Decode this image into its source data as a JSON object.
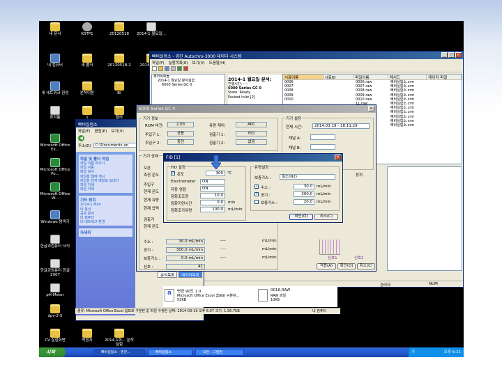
{
  "desktop_icons": [
    {
      "label": "내 문서",
      "type": "folder"
    },
    {
      "label": "KSTP1",
      "type": "cd"
    },
    {
      "label": "20120518",
      "type": "folder"
    },
    {
      "label": "2014-1 월요일...",
      "type": "disk"
    },
    {
      "label": "내 컴퓨터",
      "type": "pc"
    },
    {
      "label": "새 폴더",
      "type": "folder"
    },
    {
      "label": "20120518-2",
      "type": "folder"
    },
    {
      "label": "2014-1 Mon",
      "type": "folder"
    },
    {
      "label": "내 네트워크 환경",
      "type": "pc"
    },
    {
      "label": "분석이론",
      "type": "folder"
    },
    {
      "label": "BI",
      "type": "folder"
    },
    {
      "label": "휴지통",
      "type": "disk"
    },
    {
      "label": "1",
      "type": "folder"
    },
    {
      "label": "플라",
      "type": "folder"
    },
    {
      "label": "Microsoft Office Ex...",
      "type": "excel"
    },
    {
      "label": "Microsoft Office Po...",
      "type": "excel"
    },
    {
      "label": "Microsoft Office W...",
      "type": "excel"
    },
    {
      "label": "Windows 탐색기",
      "type": "pc"
    },
    {
      "label": "한글과컴퓨터 서식",
      "type": "disk"
    },
    {
      "label": "한글과컴퓨터 한글 2007",
      "type": "disk"
    },
    {
      "label": "pH-Meter",
      "type": "disk"
    },
    {
      "label": "dpv-2-5",
      "type": "folder"
    },
    {
      "label": "CV 실험화면",
      "type": "folder"
    },
    {
      "label": "박원지",
      "type": "folder"
    },
    {
      "label": "2014-1화... 분석실험",
      "type": "folder"
    }
  ],
  "main_window": {
    "title": "삐비실험소 - 영진 Autochro-3000 데이터 시스템",
    "menu": [
      "파일(F)",
      "실행목록(E)",
      "보기(V)",
      "도움말(H)"
    ],
    "tree": [
      "제어목록들",
      "2014-1 월요일 분석실험",
      "6000 Series GC 0"
    ],
    "tree_header": "제어목록들",
    "info_title": "2014-1 월요일 분석:",
    "info_lines": [
      "진행시간: ----",
      "6000 Series GC 0",
      "State: Ready",
      "Packed Inlet [2]"
    ],
    "columns": [
      "시료이름",
      "시료ID",
      "파일이름",
      "메서드",
      "데이터 파일"
    ],
    "rows": [
      {
        "id": "0006",
        "file": "0006.raw",
        "method": "삐비실험소.crm"
      },
      {
        "id": "0007",
        "file": "0007.raw",
        "method": "삐비실험소.crm"
      },
      {
        "id": "0008",
        "file": "0008.raw",
        "method": "삐비실험소.crm"
      },
      {
        "id": "0009",
        "file": "0009.raw",
        "method": "삐비실험소.crm"
      },
      {
        "id": "0010",
        "file": "0010.raw",
        "method": "삐비실험소.crm"
      },
      {
        "id": "",
        "file": "11.raw",
        "method": "삐비실험소.crm"
      },
      {
        "id": "",
        "file": "12.raw",
        "method": "삐비실험소.crm"
      },
      {
        "id": "",
        "file": "13.raw",
        "method": "삐비실험소.crm"
      },
      {
        "id": "",
        "file": "14.raw",
        "method": "삐비실험소.crm"
      },
      {
        "id": "",
        "file": "15.raw",
        "method": "삐비실험소.crm"
      },
      {
        "id": "",
        "file": "16.raw",
        "method": "삐비실험소.crm"
      }
    ]
  },
  "explorer": {
    "title": "삐비실험소",
    "menu": [
      "파일(F)",
      "편집(E)",
      "보기(V)"
    ],
    "address_label": "주소(D)",
    "address": "C:\\Documents an",
    "tasks_title": "파일 및 폴더 작업",
    "tasks": [
      "파일 이름 바꾸기",
      "파일 이동",
      "파일 복사",
      "파일을 웹에 게시",
      "파일을 전자 메일로 보내기",
      "파일 인쇄",
      "파일 삭제"
    ],
    "places_title": "기타 위치",
    "places": [
      "2014-1 Mon",
      "내 문서",
      "공유 문서",
      "내 컴퓨터",
      "내 네트워크 환경"
    ],
    "details_title": "자세히",
    "files": [
      {
        "name": "변경 90도 1.0",
        "desc": "Microsoft Office Excel 쉼표로 구분된...",
        "size": "53KB"
      },
      {
        "name": "0016.RAW",
        "desc": "RAW 파일",
        "size": "10KB"
      }
    ],
    "status": "종류: Microsoft Office Excel 쉼표로 구분된 값 파일 수정한 날짜: 2014-03-19 오후 6:07 크기: 1.56.7KB",
    "status_right": "내 컴퓨터"
  },
  "gc_window": {
    "title": "6000 Series GC 0",
    "info_group": "기기 정보",
    "rom_label": "ROM 버전:",
    "rom_value": "2.03",
    "flow_label": "유량 제어:",
    "flow_value": "APC",
    "inj1_label": "주입구 1:",
    "inj1_value": "공용",
    "det1_label": "검출기 1:",
    "det1_value": "FID",
    "inj2_label": "주입구 2:",
    "inj2_value": "충전",
    "det2_label": "검출기 2:",
    "det2_value": "없음",
    "settings_group": "기기 설정",
    "time_label": "현재 시간:",
    "time_value": "2014.03.19 - 18:11:29",
    "chA_label": "채널 A:",
    "chB_label": "채널 B:",
    "status_group": "기기 상태",
    "oven_label": "오븐",
    "measured_label": "측정 온도",
    "inj_label": "주입구",
    "cur_temp_label": "현재 온도",
    "cur_flow_label": "현재 유량",
    "cur_press_label": "현재 압력",
    "detector_label": "검출기",
    "det_temp_label": "현재 온도",
    "gas_rows": [
      {
        "label": "수소 :",
        "value": "30.0 mL/min",
        "dash": "----",
        "unit": "mL/min"
      },
      {
        "label": "공기 :",
        "value": "300.0 mL/min",
        "dash": "----",
        "unit": "mL/min"
      },
      {
        "label": "보충가스 :",
        "value": "0.0 mL/min",
        "dash": "----",
        "unit": "mL/min"
      },
      {
        "label": "신호 :",
        "value": "41",
        "dash": "",
        "unit": ""
      }
    ],
    "signal_label": "신호 :",
    "mini_signals": [
      "신호1",
      "신호2"
    ],
    "axis_labels": [
      "0.80",
      "0.80",
      "0.80"
    ],
    "bottom_buttons": [
      "적용(A)",
      "확인(O)",
      "취소(C)"
    ],
    "apply_label": "적용(A)",
    "ok_label": "확인(O)",
    "cancel_label": "취소(C)",
    "extra_label": "장치"
  },
  "fid_dialog": {
    "title": "FID [1]",
    "fid_group": "FID 설정",
    "temp_label": "온도",
    "temp_value": "300",
    "temp_unit": "℃",
    "electrometer_label": "Electrometer",
    "electrometer_value": "ON",
    "autozero_label": "자동 영점",
    "autozero_value": "ON",
    "ignite_label": "점화조조정",
    "ignite_value": "10.0",
    "ignite_time_label": "점화지연시간",
    "ignite_time_value": "0.0",
    "ignite_time_unit": "min",
    "ignite_flow_label": "점화조가유량",
    "ignite_flow_value": "100.0",
    "ignite_flow_unit": "mL/min",
    "flow_group": "유량설정",
    "makeup_label": "보충가스 :",
    "makeup_value": "질소(N2)",
    "flows": [
      {
        "label": "수소 :",
        "value": "30.0",
        "unit": "mL/min",
        "checked": true
      },
      {
        "label": "공기 :",
        "value": "300.0",
        "unit": "mL/min",
        "checked": true
      },
      {
        "label": "보충가스 :",
        "value": "20.0",
        "unit": "mL/min",
        "checked": false
      }
    ],
    "ok_label": "확인(O)",
    "cancel_label": "취소(C)",
    "arrow_color": "#3a7bd5"
  },
  "taskbar": {
    "start": "시작",
    "tasks": [
      "삐비실험소 - 영진...",
      "삐비실험소",
      "오븐 - 그림판"
    ],
    "lang": "가",
    "time": "오후 6:11"
  },
  "statusbar_main": {
    "user": "관리자",
    "num": "NUM"
  },
  "main_tabs": [
    "분석목록",
    "데이터목록"
  ]
}
